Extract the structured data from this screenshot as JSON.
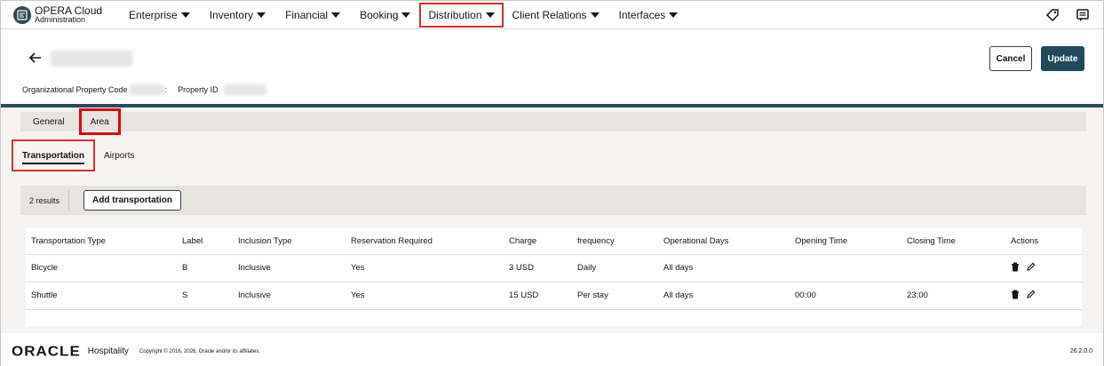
{
  "brand": {
    "name": "OPERA Cloud",
    "sub": "Administration"
  },
  "nav": [
    {
      "label": "Enterprise"
    },
    {
      "label": "Inventory"
    },
    {
      "label": "Financial"
    },
    {
      "label": "Booking"
    },
    {
      "label": "Distribution"
    },
    {
      "label": "Client Relations"
    },
    {
      "label": "Interfaces"
    }
  ],
  "header": {
    "org_code_label": "Organizational Property Code",
    "property_id_label": "Property ID",
    "colon": ":"
  },
  "buttons": {
    "cancel": "Cancel",
    "update": "Update",
    "add": "Add transportation"
  },
  "tabs": [
    {
      "label": "General"
    },
    {
      "label": "Area"
    }
  ],
  "subtabs": [
    {
      "label": "Transportation"
    },
    {
      "label": "Airports"
    }
  ],
  "results": "2 results",
  "table": {
    "headers": [
      "Transportation Type",
      "Label",
      "Inclusion Type",
      "Reservation Required",
      "Charge",
      "frequency",
      "Operational Days",
      "Opening Time",
      "Closing Time",
      "Actions"
    ],
    "rows": [
      [
        "Bicycle",
        "B",
        "Inclusive",
        "Yes",
        "3 USD",
        "Daily",
        "All days",
        "",
        ""
      ],
      [
        "Shuttle",
        "S",
        "Inclusive",
        "Yes",
        "15 USD",
        "Per stay",
        "All days",
        "00:00",
        "23:00"
      ]
    ]
  },
  "footer": {
    "oracle": "ORACLE",
    "hospitality": "Hospitality",
    "copyright": "Copyright © 2016, 2026, Oracle and/or its affiliates.",
    "version": "26.2.0.0"
  },
  "colors": {
    "accent": "#1f4a5c",
    "highlight": "#d9312b"
  },
  "icons": {
    "back": "arrow-left-icon",
    "delete": "trash-icon",
    "edit": "pencil-icon"
  }
}
